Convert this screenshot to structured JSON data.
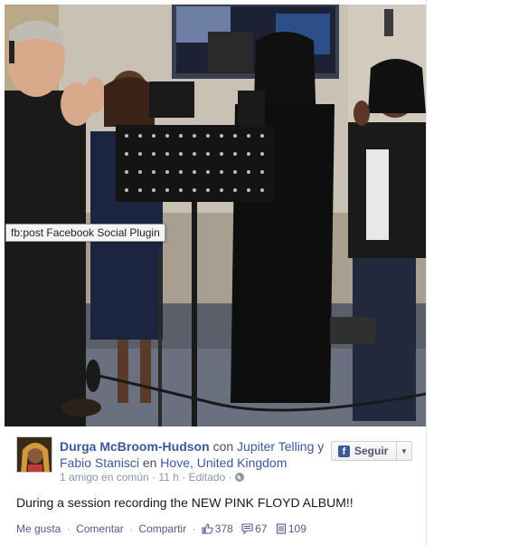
{
  "tooltip": {
    "text": "fb:post Facebook Social Plugin"
  },
  "post": {
    "author": "Durga McBroom-Hudson",
    "with_word": "con",
    "tagged_1": "Jupiter Telling",
    "and_word": "y",
    "tagged_2": "Fabio Stanisci",
    "in_word": "en",
    "location": "Hove, United Kingdom",
    "mutual_friends": "1 amigo en común",
    "time": "11 h",
    "edited": "Editado",
    "text": "During a session recording the NEW PINK FLOYD ALBUM!!",
    "follow_label": "Seguir"
  },
  "actions": {
    "like": "Me gusta",
    "comment": "Comentar",
    "share": "Compartir",
    "likes_count": "378",
    "comments_count": "67",
    "shares_count": "109"
  },
  "icons": {
    "globe": "globe-icon",
    "facebook": "facebook-logo-icon",
    "caret": "chevron-down-icon",
    "like": "thumbs-up-icon",
    "comment": "comment-bubble-icon",
    "share": "share-document-icon"
  },
  "colors": {
    "link_blue": "#3b5998",
    "meta_gray": "#90949c",
    "text_dark": "#141823"
  }
}
